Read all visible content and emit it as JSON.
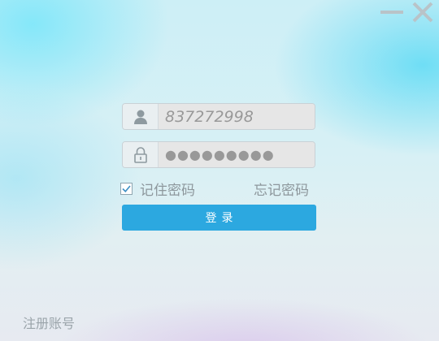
{
  "window_controls": {
    "minimize_icon": "minimize-icon",
    "close_icon": "close-icon"
  },
  "login_form": {
    "username": {
      "icon": "user-icon",
      "value": "837272998"
    },
    "password": {
      "icon": "lock-icon",
      "masked_value": "●●●●●●●●●"
    },
    "remember": {
      "label": "记住密码",
      "checked": true
    },
    "forgot_label": "忘记密码",
    "login_label": "登录"
  },
  "register_label": "注册账号",
  "colors": {
    "accent": "#2ca8e0",
    "muted_text": "#8d979c",
    "field_bg": "#e6e6e6"
  }
}
